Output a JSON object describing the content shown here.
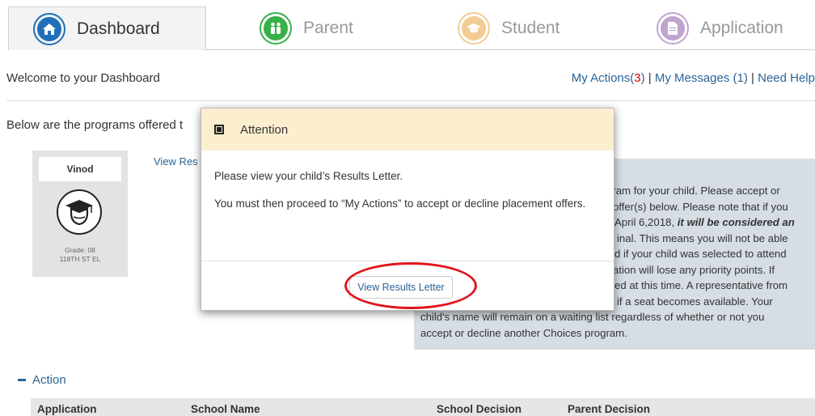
{
  "tabs": [
    {
      "label": "Dashboard",
      "icon": "home-icon",
      "color": "#1f6fb8",
      "active": true
    },
    {
      "label": "Parent",
      "icon": "parents-icon",
      "color": "#38b04a"
    },
    {
      "label": "Student",
      "icon": "graduation-cap-icon",
      "color": "#e8a33c"
    },
    {
      "label": "Application",
      "icon": "document-icon",
      "color": "#8e5aa8"
    }
  ],
  "welcome": "Welcome to your Dashboard",
  "top_links": {
    "my_actions": "My Actions(",
    "actions_count": "3",
    "actions_close": ")",
    "sep1": " | ",
    "my_messages": "My Messages  (1)",
    "sep2": " | ",
    "need_help": "Need Help"
  },
  "programs_text": "Below are the programs offered t",
  "child": {
    "name": "Vinod",
    "grade": "Grade: 08",
    "school": "118TH ST EL"
  },
  "view_results_link": "View Res",
  "info": {
    "line1": "gram for your child. Please accept or",
    "line2": "offer(s) below. Please note that if you",
    "line3_a": "April 6,2018, ",
    "line3_b": "it will be considered an",
    "line4": "inal. This means you will not be able",
    "line5": "d if your child was selected to attend",
    "line6": "ation will lose any priority points. If",
    "line7": "ed at this time. A representative from",
    "line8": "if a seat becomes available. Your",
    "line9": "child's name will remain on a waiting list regardless of whether or not you",
    "line10": "accept or decline another Choices program."
  },
  "action_section": "Action",
  "table_headers": [
    "Application",
    "School Name",
    "School Decision",
    "Parent Decision"
  ],
  "modal": {
    "title": "Attention",
    "line1": "Please view your child’s Results Letter.",
    "line2": "You must then proceed to “My Actions” to accept or decline placement offers.",
    "button": "View Results Letter"
  },
  "colors": {
    "link": "#2a6496",
    "alert_count": "#dd0000",
    "modal_header": "#fcefcf",
    "info_box": "#d6dde4",
    "highlight": "#e0151c"
  }
}
